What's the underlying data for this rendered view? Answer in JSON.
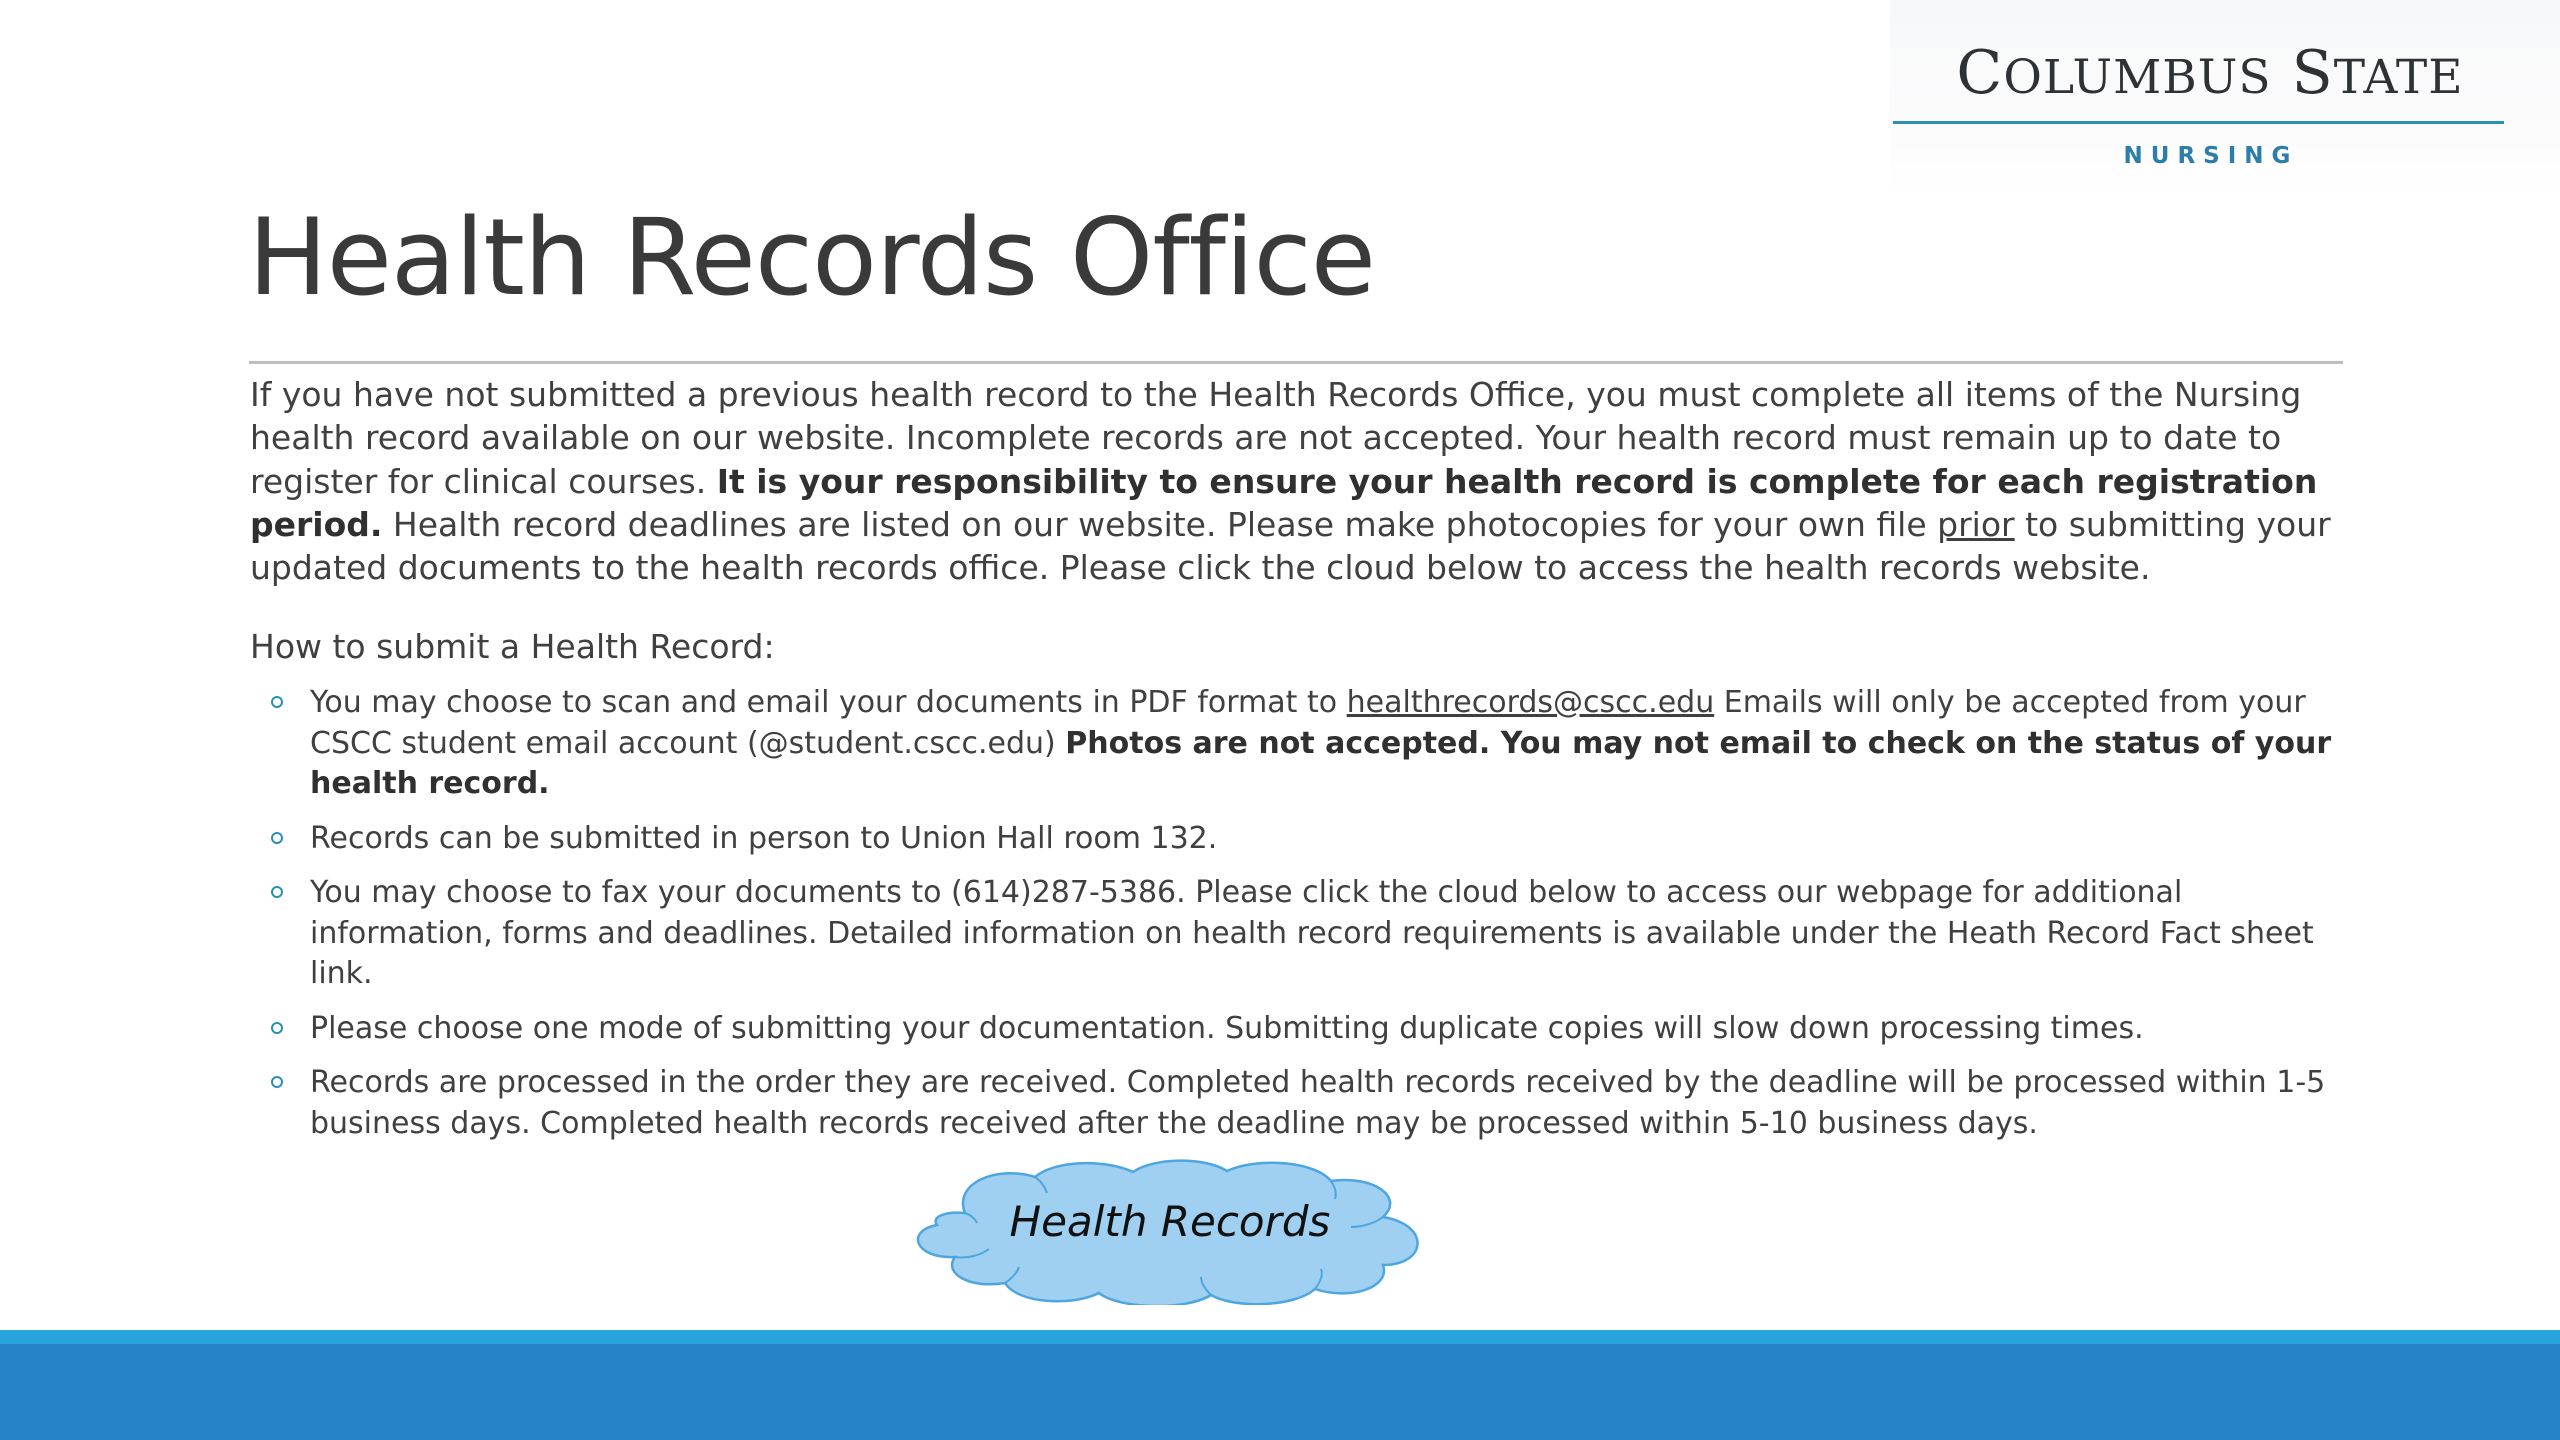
{
  "logo": {
    "name_first_initial": "C",
    "name_first_rest": "OLUMBUS",
    "name_second_initial": "S",
    "name_second_rest": "TATE",
    "subtitle": "NURSING"
  },
  "title": "Health Records Office",
  "intro": {
    "part1": "If you have not submitted a previous health record to the Health Records Office, you must complete all items of the Nursing health record available on our website. Incomplete records are not accepted. Your health record must remain up to date to register for clinical courses.  ",
    "bold": "It is your responsibility to ensure your health record is complete for each registration period.",
    "part2": " Health record deadlines are listed on our website. Please make photocopies for your own file ",
    "underlined": "prior",
    "part3": " to submitting your updated documents to the health records office. Please click the cloud below to access the health records website."
  },
  "how_to": "How to submit a Health Record:",
  "bullets": {
    "b1": {
      "text1": "You may choose to scan and email your documents in PDF format to ",
      "email": "healthrecords@cscc.edu",
      "text2": " Emails will only be accepted from your CSCC student email account (@student.cscc.edu) ",
      "bold": "Photos are not accepted. You may not email to check on the status of your health record."
    },
    "b2": "Records can be submitted in person to Union Hall room 132.",
    "b3": "You may choose to fax your documents to (614)287-5386.   Please click the cloud below to access our webpage for additional information, forms and deadlines.  Detailed information on health record requirements is available under the Heath Record Fact sheet link.",
    "b4": "Please choose one mode of submitting your documentation.  Submitting duplicate copies will slow down processing times.",
    "b5": "Records are processed in the order they are received.  Completed health records received by the deadline will be processed within 1-5 business days. Completed health records received after the deadline may be processed within 5-10 business days."
  },
  "cloud_button": {
    "label": "Health Records"
  },
  "colors": {
    "accent": "#2a8fb7",
    "band_light": "#28a4dc",
    "band_dark": "#2582c4",
    "cloud_fill": "#9fd0f1",
    "cloud_stroke": "#4ea6e0"
  }
}
